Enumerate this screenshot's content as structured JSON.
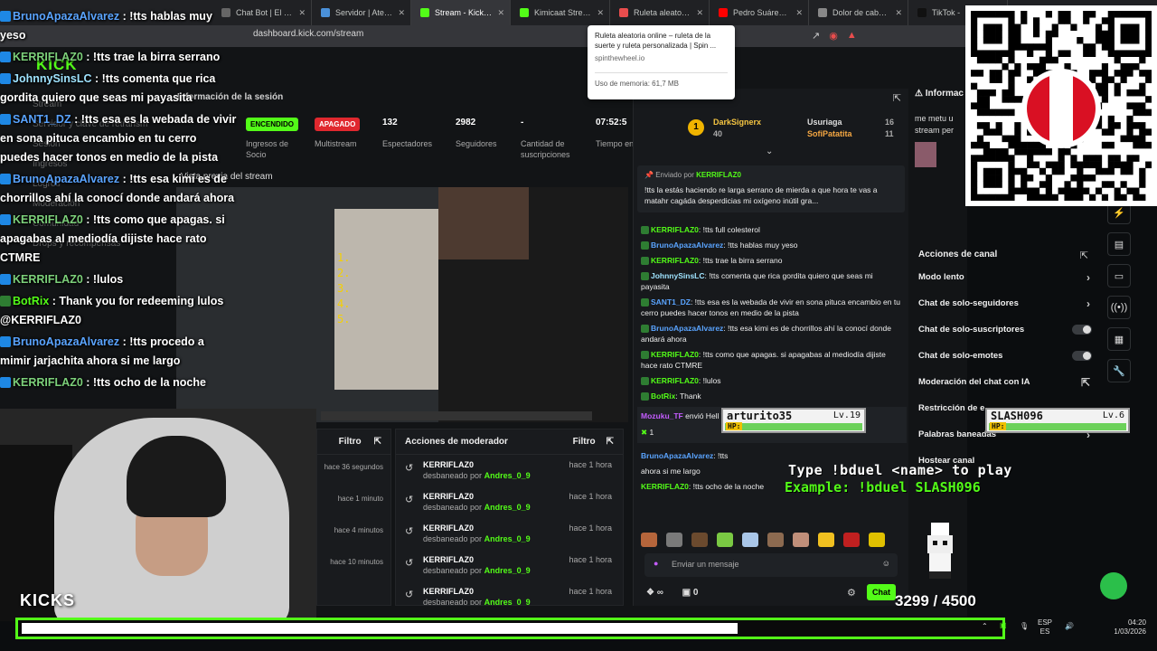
{
  "browser": {
    "tabs": [
      {
        "label": "Chat Bot | El mejor sof",
        "color": "#666666",
        "active": false
      },
      {
        "label": "Servidor | Aternos | Se",
        "color": "#4a90d9",
        "active": false
      },
      {
        "label": "Stream - Kick Dash",
        "color": "#53fc18",
        "active": true
      },
      {
        "label": "Kimicaat Stream - ",
        "color": "#53fc18",
        "active": false
      },
      {
        "label": "Ruleta aleatoria on",
        "color": "#e94d4d",
        "active": false
      },
      {
        "label": "Pedro Suárez Vértiz - ",
        "color": "#ff0000",
        "active": false
      },
      {
        "label": "Dolor de cabeza y abs",
        "color": "#888888",
        "active": false
      },
      {
        "label": "TikTok -",
        "color": "#111111",
        "active": false
      }
    ],
    "url": "dashboard.kick.com/stream"
  },
  "tooltip": {
    "title": "Ruleta aleatoria online – ruleta de la suerte y ruleta personalizada | Spin ...",
    "domain": "spinthewheel.io",
    "memory": "Uso de memoria: 61,7 MB"
  },
  "dashboard": {
    "logo": "KICK",
    "nav": [
      "Stream",
      "Servidor y clave de retransm",
      "Sesión",
      "Ingresos",
      "Logros",
      "Moderación",
      "Comunidad",
      "Drops y recompensas"
    ],
    "section_title": "Información de la sesión",
    "stats": [
      {
        "value": "ENCENDIDO",
        "label": "Ingresos de Socio",
        "pill": "#53fc18",
        "pill_text": "#000000"
      },
      {
        "value": "APAGADO",
        "label": "Multistream",
        "pill": "#e0282e",
        "pill_text": "#ffffff"
      },
      {
        "value": "132",
        "label": "Espectadores"
      },
      {
        "value": "2982",
        "label": "Seguidores"
      },
      {
        "value": "-",
        "label": "Cantidad de suscripciones"
      },
      {
        "value": "07:52:5",
        "label": "Tiempo en vivo"
      }
    ],
    "preview_title": "Vista previa del stream",
    "preview_numbers": [
      "1.",
      "2.",
      "3.",
      "4.",
      "5."
    ]
  },
  "moderator": {
    "title": "Acciones de moderador",
    "filter": "Filtro",
    "left_filter": "Filtro",
    "left_times": [
      "hace 36 segundos",
      "hace 1 minuto",
      "hace 4 minutos",
      "hace 10 minutos"
    ],
    "rows": [
      {
        "user": "KERRIFLAZ0",
        "action": "desbaneado por",
        "by": "Andres_0_9",
        "time": "hace 1 hora"
      },
      {
        "user": "KERRIFLAZ0",
        "action": "desbaneado por",
        "by": "Andres_0_9",
        "time": "hace 1 hora"
      },
      {
        "user": "KERRIFLAZ0",
        "action": "desbaneado por",
        "by": "Andres_0_9",
        "time": "hace 1 hora"
      },
      {
        "user": "KERRIFLAZ0",
        "action": "desbaneado por",
        "by": "Andres_0_9",
        "time": "hace 1 hora"
      },
      {
        "user": "KERRIFLAZ0",
        "action": "desbaneado por",
        "by": "Andres_0_9",
        "time": "hace 1 hora"
      }
    ]
  },
  "chat": {
    "leaders": [
      {
        "name": "DarkSignerx",
        "count": "40"
      },
      {
        "name": "Usuriaga",
        "count": "16"
      },
      {
        "name": "SofiPatatita",
        "count": "11"
      }
    ],
    "pinned_header": "Enviado por",
    "pinned_user": "KERRIFLAZ0",
    "pinned_text": "!tts la estás haciendo re larga serrano de mierda a que hora te vas a matahr cagáda desperdicias mi oxígeno inútil gra...",
    "messages": [
      {
        "user": "KERRIFLAZ0",
        "color": "#53fc18",
        "text": "!tts full colesterol"
      },
      {
        "user": "BrunoApazaAlvarez",
        "color": "#5aa4ff",
        "text": "!tts hablas muy yeso"
      },
      {
        "user": "KERRIFLAZ0",
        "color": "#53fc18",
        "text": "!tts trae la birra serrano"
      },
      {
        "user": "JohnnySinsLC",
        "color": "#9fe3ff",
        "text": "!tts comenta que rica gordita quiero que seas mi payasita"
      },
      {
        "user": "SANT1_DZ",
        "color": "#5aa4ff",
        "text": "!tts esa es la webada de vivir en sona pituca encambio en tu cerro puedes hacer tonos en medio de la pista"
      },
      {
        "user": "BrunoApazaAlvarez",
        "color": "#5aa4ff",
        "text": "!tts esa kimi es de chorrillos ahí la conocí donde andará ahora"
      },
      {
        "user": "KERRIFLAZ0",
        "color": "#53fc18",
        "text": "!tts como que apagas. si apagabas al mediodía dijiste hace rato CTMRE"
      },
      {
        "user": "KERRIFLAZ0",
        "color": "#53fc18",
        "text": "!lulos"
      },
      {
        "user": "BotRix",
        "color": "#53fc18",
        "text": "Thank"
      }
    ],
    "gift_user": "Mozuku_TF",
    "gift_text": "envió Hell Yeah",
    "gift_count": "1",
    "messages2": [
      {
        "user": "BrunoApazaAlvarez",
        "color": "#5aa4ff",
        "text": "!tts"
      },
      {
        "user": "",
        "color": "#eeeeee",
        "text": "ahora si me largo"
      },
      {
        "user": "KERRIFLAZ0",
        "color": "#53fc18",
        "text": "!tts ocho de la noche"
      }
    ],
    "input_placeholder": "Enviar un mensaje",
    "send_label": "Chat",
    "footer_count": "0"
  },
  "channel": {
    "title": "Acciones de canal",
    "rows": [
      "Modo lento",
      "Chat de solo-seguidores",
      "Chat de solo-suscriptores",
      "Chat de solo-emotes",
      "Moderación del chat con IA",
      "Restricción de e",
      "Palabras baneadas",
      "Hostear canal"
    ]
  },
  "info": {
    "title": "Informac",
    "text": "me metu u stream per"
  },
  "overlay_chat": [
    {
      "user": "BrunoApazaAlvarez",
      "cls": "n",
      "text": "!tts hablas muy yeso"
    },
    {
      "user": "KERRIFLAZ0",
      "cls": "n g",
      "text": "!tts trae la birra serrano"
    },
    {
      "user": "JohnnySinsLC",
      "cls": "n j",
      "text": "!tts comenta que rica gordita quiero que seas mi payasita"
    },
    {
      "user": "SANT1_DZ",
      "cls": "n",
      "text": "!tts esa es la webada de vivir en sona pituca encambio en tu cerro puedes hacer tonos en medio de la pista"
    },
    {
      "user": "BrunoApazaAlvarez",
      "cls": "n",
      "text": "!tts esa kimi es de chorrillos ahí la conocí donde andará ahora"
    },
    {
      "user": "KERRIFLAZ0",
      "cls": "n g",
      "text": "!tts como que apagas. si apagabas al mediodía dijiste hace rato CTMRE"
    },
    {
      "user": "KERRIFLAZ0",
      "cls": "n g",
      "text": "!lulos"
    },
    {
      "user": "BotRix",
      "cls": "n bot",
      "text": "Thank you for redeeming lulos @KERRIFLAZ0"
    },
    {
      "user": "BrunoApazaAlvarez",
      "cls": "n",
      "text": "!tts procedo a mimir jarjachita ahora si me largo"
    },
    {
      "user": "KERRIFLAZ0",
      "cls": "n g",
      "text": "!tts ocho de la noche"
    }
  ],
  "game": {
    "p1_name": "arturito35",
    "p1_level": "Lv.19",
    "p2_name": "SLASH096",
    "p2_level": "Lv.6",
    "hp_label": "HP:",
    "duel_line1": "Type !bduel <name> to play",
    "duel_line2": "Example: !bduel SLASH096",
    "score": "3299 / 4500",
    "score_fraction": 0.733,
    "kicks_label": "KICKS"
  },
  "taskbar": {
    "lang_top": "ESP",
    "lang_bottom": "ES",
    "time": "04:20",
    "date": "1/03/2026"
  }
}
